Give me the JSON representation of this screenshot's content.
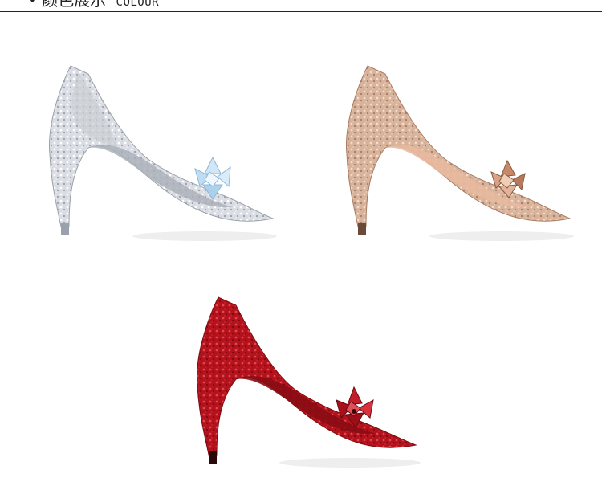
{
  "header": {
    "bullet": "•",
    "title_cn": "颜色展示",
    "title_en": "COLOUR"
  },
  "colors": {
    "silver": "#d9dce2",
    "silver_dark": "#a9afb8",
    "champagne": "#d7b39b",
    "champagne_dark": "#b08670",
    "red": "#b3121c",
    "red_dark": "#7d0a10"
  },
  "shoes": [
    {
      "name": "silver-crystal-pump"
    },
    {
      "name": "champagne-crystal-pump"
    },
    {
      "name": "red-crystal-pump"
    }
  ]
}
